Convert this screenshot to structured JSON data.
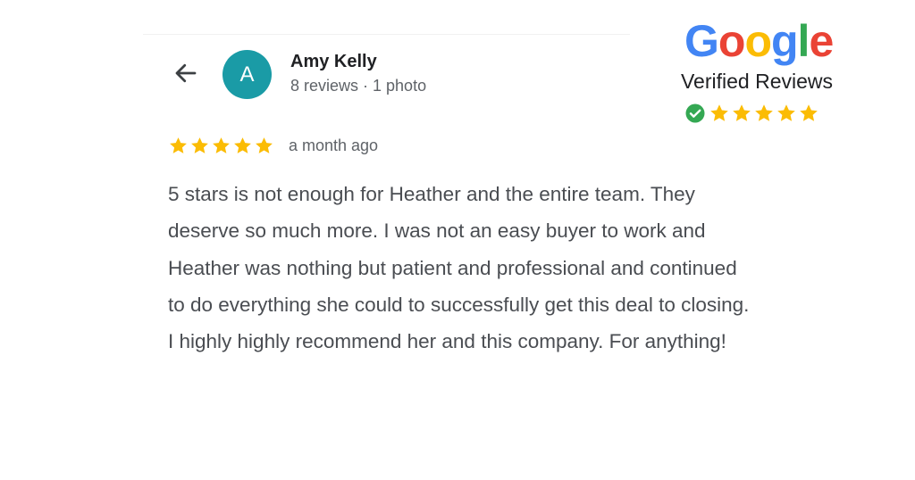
{
  "colors": {
    "star": "#FBBC04",
    "avatar_bg": "#1A9BA6",
    "verified_green": "#34A853",
    "google_blue": "#4285F4",
    "google_red": "#EA4335",
    "google_yellow": "#FBBC05",
    "google_green": "#34A853"
  },
  "header": {
    "back_icon": "arrow-left-icon",
    "avatar_initial": "A",
    "reviewer_name": "Amy Kelly",
    "reviewer_meta": "8 reviews · 1 photo"
  },
  "review": {
    "rating": 5,
    "rating_max": 5,
    "time": "a month ago",
    "text": "5 stars is not enough for Heather and the entire team. They deserve so much more. I was not an easy buyer to work and Heather was nothing but patient and professional and continued to do everything she could to successfully get this deal to closing. I highly highly recommend her and this company. For anything!"
  },
  "badge": {
    "logo_letters": [
      "G",
      "o",
      "o",
      "g",
      "l",
      "e"
    ],
    "subtitle": "Verified Reviews",
    "icon": "check-circle-icon",
    "rating": 5
  }
}
